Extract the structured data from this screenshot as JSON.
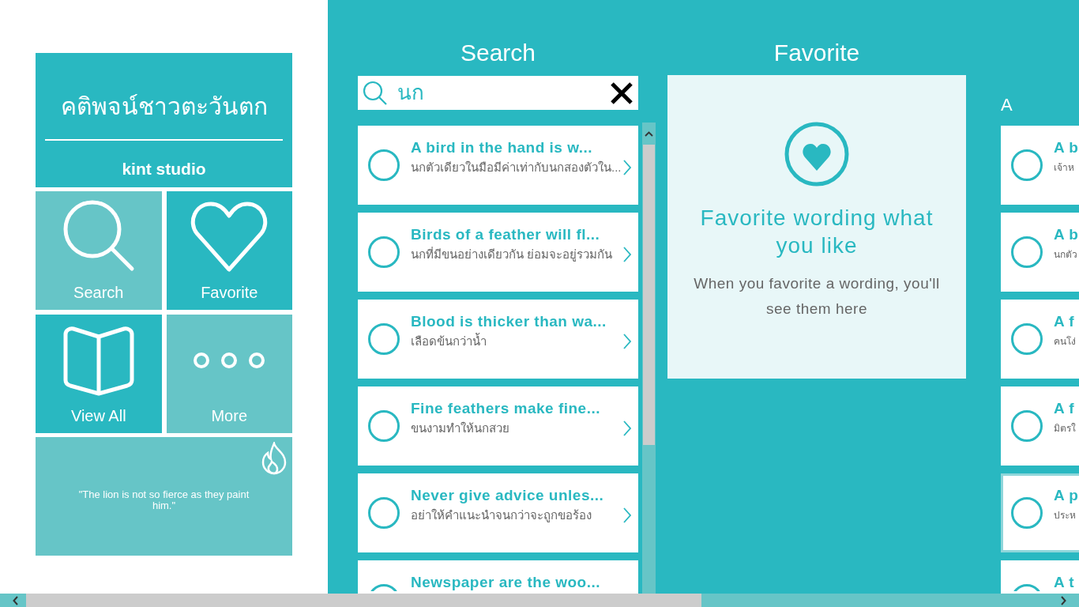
{
  "app": {
    "title": "คติพจน์ชาวตะวันตก",
    "publisher": "kint studio"
  },
  "tiles": [
    {
      "kind": "search",
      "label": "Search",
      "color": "#66c5c7"
    },
    {
      "kind": "heart",
      "label": "Favorite",
      "color": "#29b8c1"
    },
    {
      "kind": "book",
      "label": "View All",
      "color": "#29b8c1"
    },
    {
      "kind": "more",
      "label": "More",
      "color": "#66c5c7"
    }
  ],
  "quote_tile": {
    "quote": "\"The lion is not so fierce as they paint him.\""
  },
  "search": {
    "heading": "Search",
    "value": "นก",
    "results": [
      {
        "title": "A bird in the hand is w...",
        "subtitle": "นกตัวเดียวในมือมีค่าเท่ากับนกสองตัวใน...",
        "selected": false
      },
      {
        "title": "Birds of a feather will fl...",
        "subtitle": "นกที่มีขนอย่างเดียวกัน ย่อมจะอยู่รวมกัน",
        "selected": false
      },
      {
        "title": "Blood is thicker than wa...",
        "subtitle": "เลือดข้นกว่าน้ำ",
        "selected": false
      },
      {
        "title": "Fine feathers make fine...",
        "subtitle": "ขนงามทำให้นกสวย",
        "selected": false
      },
      {
        "title": "Never give advice unles...",
        "subtitle": "อย่าให้คำแนะนำจนกว่าจะถูกขอร้อง",
        "selected": false
      },
      {
        "title": "Newspaper are the woo...",
        "selected": false
      }
    ]
  },
  "favorite": {
    "heading": "Favorite",
    "title": "Favorite wording what you like",
    "message": "When you favorite a wording, you'll see them here"
  },
  "all": {
    "group": "A",
    "items": [
      {
        "title": "A b",
        "subtitle": "เจ้าห",
        "selected": false
      },
      {
        "title": "A b",
        "subtitle": "นกตัว",
        "selected": false
      },
      {
        "title": "A f",
        "subtitle": "คนโง่",
        "selected": false
      },
      {
        "title": "A f",
        "subtitle": "มิตรใ",
        "selected": false
      },
      {
        "title": "A p",
        "subtitle": "ประห",
        "selected": true
      },
      {
        "title": "A t",
        "selected": false
      }
    ]
  }
}
